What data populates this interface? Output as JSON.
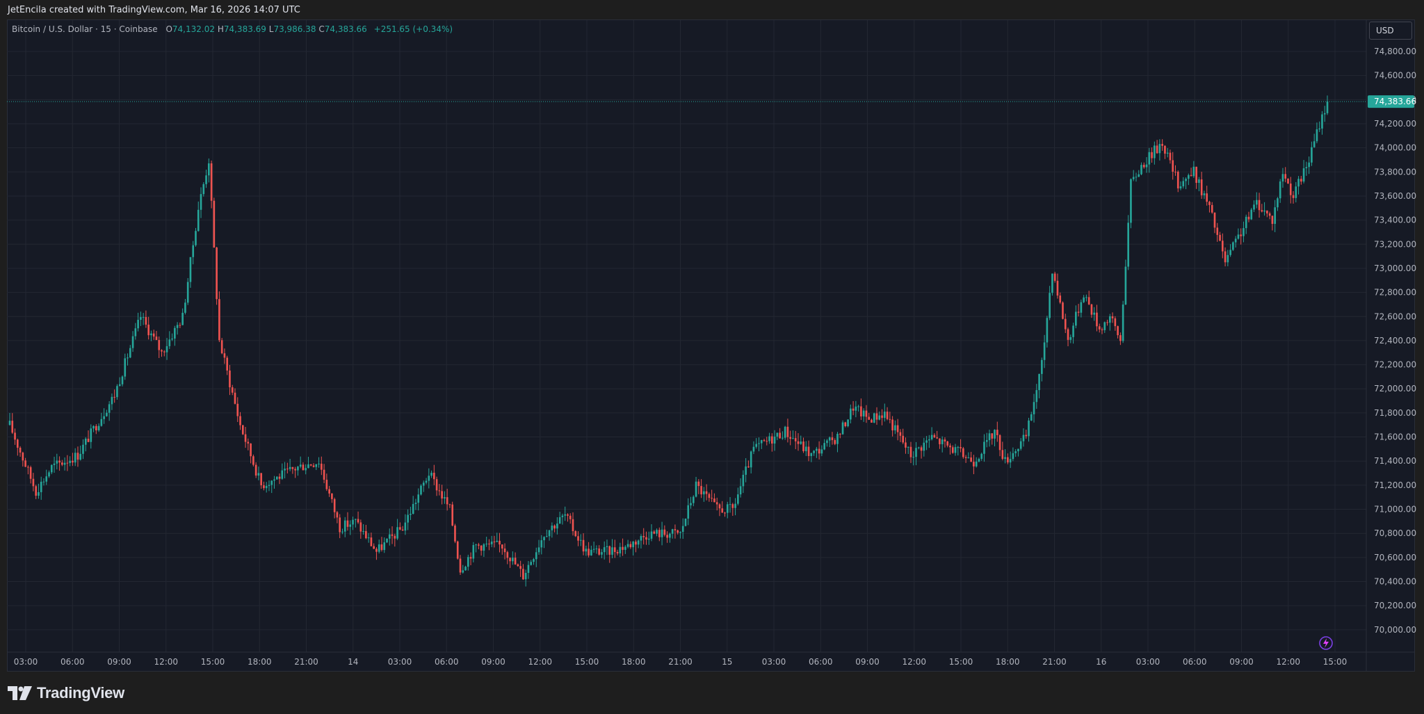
{
  "header": {
    "attribution": "JetEncila created with TradingView.com, Mar 16, 2026 14:07 UTC"
  },
  "legend": {
    "symbol": "Bitcoin / U.S. Dollar · 15 · Coinbase",
    "open_label": "O",
    "open": "74,132.02",
    "high_label": "H",
    "high": "74,383.69",
    "low_label": "L",
    "low": "73,986.38",
    "close_label": "C",
    "close": "74,383.66",
    "change": "+251.65 (+0.34%)"
  },
  "currency": "USD",
  "brand": "TradingView",
  "colors": {
    "up": "#26a69a",
    "down": "#ef5350",
    "background": "#161a25",
    "grid": "#232732"
  },
  "chart_data": {
    "type": "candlestick",
    "interval": "15",
    "y_ticks": [
      "74,800.00",
      "74,600.00",
      "74,400.00",
      "74,200.00",
      "74,000.00",
      "73,800.00",
      "73,600.00",
      "73,400.00",
      "73,200.00",
      "73,000.00",
      "72,800.00",
      "72,600.00",
      "72,400.00",
      "72,200.00",
      "72,000.00",
      "71,800.00",
      "71,600.00",
      "71,400.00",
      "71,200.00",
      "71,000.00",
      "70,800.00",
      "70,600.00",
      "70,400.00",
      "70,200.00",
      "70,000.00"
    ],
    "ylim": [
      69900,
      74900
    ],
    "x_ticks": [
      "03:00",
      "06:00",
      "09:00",
      "12:00",
      "15:00",
      "18:00",
      "21:00",
      "14",
      "03:00",
      "06:00",
      "09:00",
      "12:00",
      "15:00",
      "18:00",
      "21:00",
      "15",
      "03:00",
      "06:00",
      "09:00",
      "12:00",
      "15:00",
      "18:00",
      "21:00",
      "16",
      "03:00",
      "06:00",
      "09:00",
      "12:00",
      "15:00"
    ],
    "last_price": 74383.66,
    "last_price_label": "74,383.66",
    "key_points": [
      [
        0,
        71700
      ],
      [
        10,
        71150
      ],
      [
        16,
        71350
      ],
      [
        26,
        71450
      ],
      [
        40,
        71950
      ],
      [
        50,
        72600
      ],
      [
        58,
        72300
      ],
      [
        66,
        72600
      ],
      [
        72,
        73500
      ],
      [
        76,
        73900
      ],
      [
        80,
        72400
      ],
      [
        88,
        71700
      ],
      [
        96,
        71200
      ],
      [
        110,
        71350
      ],
      [
        118,
        71400
      ],
      [
        126,
        70850
      ],
      [
        132,
        70900
      ],
      [
        140,
        70650
      ],
      [
        150,
        70850
      ],
      [
        160,
        71300
      ],
      [
        168,
        71000
      ],
      [
        172,
        70500
      ],
      [
        178,
        70700
      ],
      [
        188,
        70700
      ],
      [
        196,
        70450
      ],
      [
        204,
        70800
      ],
      [
        212,
        70950
      ],
      [
        220,
        70650
      ],
      [
        228,
        70650
      ],
      [
        236,
        70700
      ],
      [
        244,
        70800
      ],
      [
        256,
        70800
      ],
      [
        262,
        71200
      ],
      [
        270,
        71000
      ],
      [
        276,
        71000
      ],
      [
        284,
        71500
      ],
      [
        296,
        71650
      ],
      [
        306,
        71450
      ],
      [
        316,
        71600
      ],
      [
        322,
        71850
      ],
      [
        328,
        71750
      ],
      [
        334,
        71800
      ],
      [
        344,
        71450
      ],
      [
        352,
        71600
      ],
      [
        360,
        71500
      ],
      [
        368,
        71400
      ],
      [
        376,
        71650
      ],
      [
        380,
        71400
      ],
      [
        388,
        71600
      ],
      [
        394,
        72200
      ],
      [
        398,
        73000
      ],
      [
        404,
        72400
      ],
      [
        410,
        72800
      ],
      [
        416,
        72500
      ],
      [
        420,
        72600
      ],
      [
        424,
        72400
      ],
      [
        428,
        73700
      ],
      [
        432,
        73850
      ],
      [
        440,
        74050
      ],
      [
        446,
        73700
      ],
      [
        452,
        73800
      ],
      [
        458,
        73500
      ],
      [
        464,
        73050
      ],
      [
        470,
        73300
      ],
      [
        476,
        73550
      ],
      [
        482,
        73400
      ],
      [
        486,
        73800
      ],
      [
        490,
        73600
      ],
      [
        496,
        73900
      ],
      [
        500,
        74200
      ],
      [
        503,
        74383.66
      ]
    ],
    "candle_count": 504
  }
}
